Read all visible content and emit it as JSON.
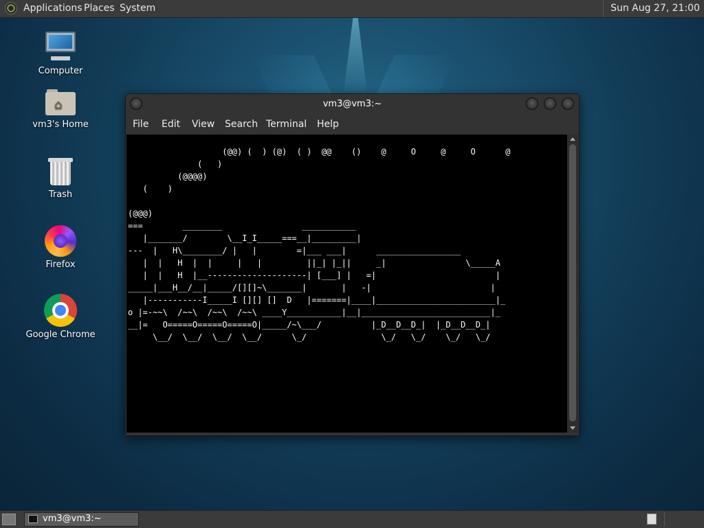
{
  "top_panel": {
    "menus": [
      "Applications",
      "Places",
      "System"
    ],
    "clock": "Sun Aug 27, 21:00"
  },
  "desktop_icons": [
    {
      "label": "Computer",
      "icon": "computer-icon"
    },
    {
      "label": "vm3's Home",
      "icon": "home-folder-icon"
    },
    {
      "label": "Trash",
      "icon": "trash-icon"
    },
    {
      "label": "Firefox",
      "icon": "firefox-icon"
    },
    {
      "label": "Google Chrome",
      "icon": "chrome-icon"
    }
  ],
  "terminal": {
    "title": "vm3@vm3:~",
    "menu": [
      "File",
      "Edit",
      "View",
      "Search",
      "Terminal",
      "Help"
    ],
    "output": "                   (@@) (  ) (@)  ( )  @@    ()    @     O     @     O      @\n              (   )\n          (@@@@)\n   (    )\n\n(@@@)\n===        ________                ___________\n   |_______/        \\__I_I_____===__|_________|\n---  |   H\\________/ |   |        =|___ ___|      _________________\n   |  |   H  |  |     |   |         ||_| |_||     _|                \\_____A\n   |  |   H  |__--------------------| [___] |   =|                        |\n_____|___H__/__|_____/[][]~\\_______|       |   -|                        |\n   |-----------I_____I [][] []  D   |=======|____|________________________|_\no |=-~~\\  /~~\\  /~~\\  /~~\\ ____Y___________|__|__________________________|_\n__|=   O=====O=====O=====O|_____/~\\___/          |_D__D__D_|  |_D__D__D_|\n     \\__/  \\__/  \\__/  \\__/      \\_/               \\_/   \\_/    \\_/   \\_/"
  },
  "taskbar": {
    "tasks": [
      {
        "label": "vm3@vm3:~"
      }
    ]
  }
}
